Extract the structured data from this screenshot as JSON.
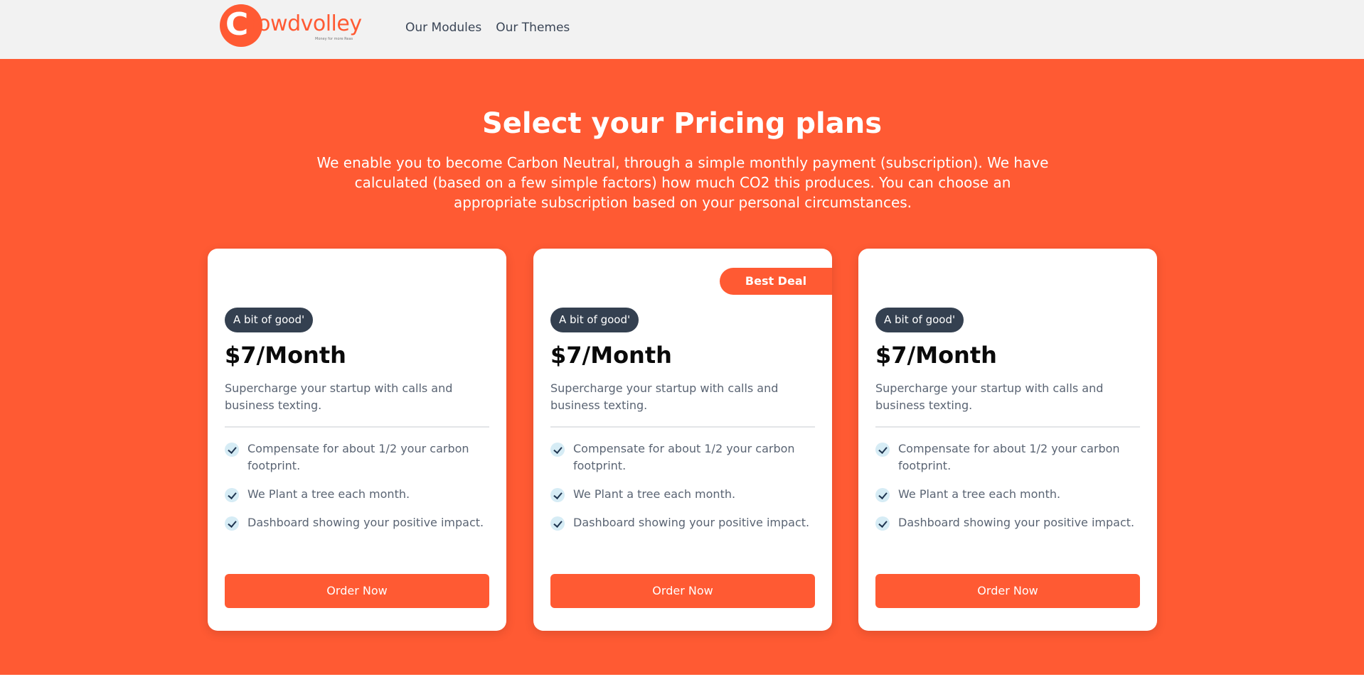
{
  "brand": {
    "logo_crowd": "Crowd",
    "logo_volley": "volley",
    "tagline": "Money for more Reas",
    "primary_color": "#ff5a33",
    "dark_color": "#344050"
  },
  "nav": {
    "items": [
      {
        "label": "Our Modules"
      },
      {
        "label": "Our Themes"
      }
    ]
  },
  "hero": {
    "title": "Select your Pricing plans",
    "subtitle": "We enable you to become Carbon Neutral, through a simple monthly payment (subscription). We have calculated (based on a few simple factors) how much CO2 this produces. You can choose an appropriate subscription based on your personal circumstances."
  },
  "plans": [
    {
      "ribbon": "",
      "badge": "A bit of good'",
      "price": "$7/Month",
      "description": "Supercharge your startup with calls and business texting.",
      "features": [
        "Compensate for about 1/2 your carbon footprint.",
        "We Plant a tree each month.",
        "Dashboard showing your positive impact."
      ],
      "button": "Order Now"
    },
    {
      "ribbon": "Best Deal",
      "badge": "A bit of good'",
      "price": "$7/Month",
      "description": "Supercharge your startup with calls and business texting.",
      "features": [
        "Compensate for about 1/2 your carbon footprint.",
        "We Plant a tree each month.",
        "Dashboard showing your positive impact."
      ],
      "button": "Order Now"
    },
    {
      "ribbon": "",
      "badge": "A bit of good'",
      "price": "$7/Month",
      "description": "Supercharge your startup with calls and business texting.",
      "features": [
        "Compensate for about 1/2 your carbon footprint.",
        "We Plant a tree each month.",
        "Dashboard showing your positive impact."
      ],
      "button": "Order Now"
    }
  ]
}
